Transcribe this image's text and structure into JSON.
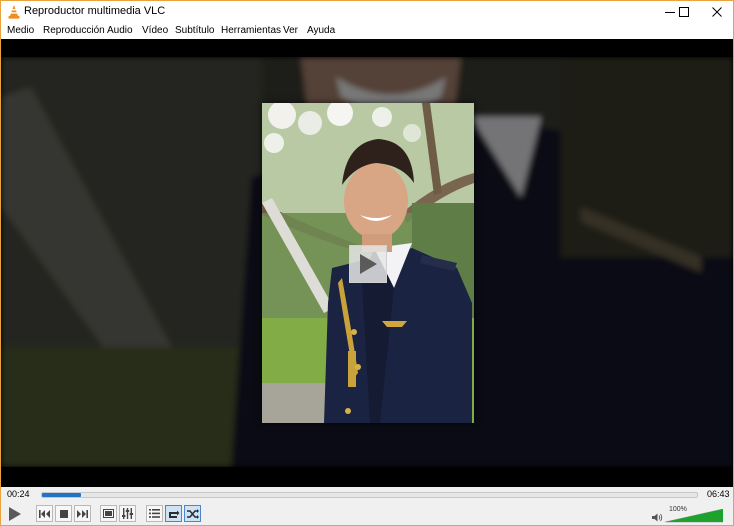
{
  "window": {
    "title": "Reproductor multimedia VLC",
    "border_color": "#e8a33c"
  },
  "menu": {
    "items": [
      "Medio",
      "Reproducción",
      "Audio",
      "Vídeo",
      "Subtítulo",
      "Herramientas",
      "Ver",
      "Ayuda"
    ]
  },
  "icons": {
    "app": "vlc-cone-icon",
    "minimize": "minimize-icon",
    "maximize": "maximize-icon",
    "close": "close-icon",
    "play_overlay": "play-icon",
    "volume": "speaker-icon"
  },
  "playback": {
    "current_time": "00:24",
    "total_time": "06:43",
    "progress_fraction": 0.06,
    "volume_label": "100%",
    "volume_fraction": 1.0,
    "accent_color": "#1f74c9",
    "volume_color": "#1ea22e"
  },
  "controls": {
    "play": "play-button",
    "previous": "previous-button",
    "stop": "stop-button",
    "next": "next-button",
    "fullscreen": "fullscreen-button",
    "extended_settings": "extended-settings-button",
    "playlist": "playlist-button",
    "loop": "loop-button",
    "shuffle": "shuffle-button"
  }
}
